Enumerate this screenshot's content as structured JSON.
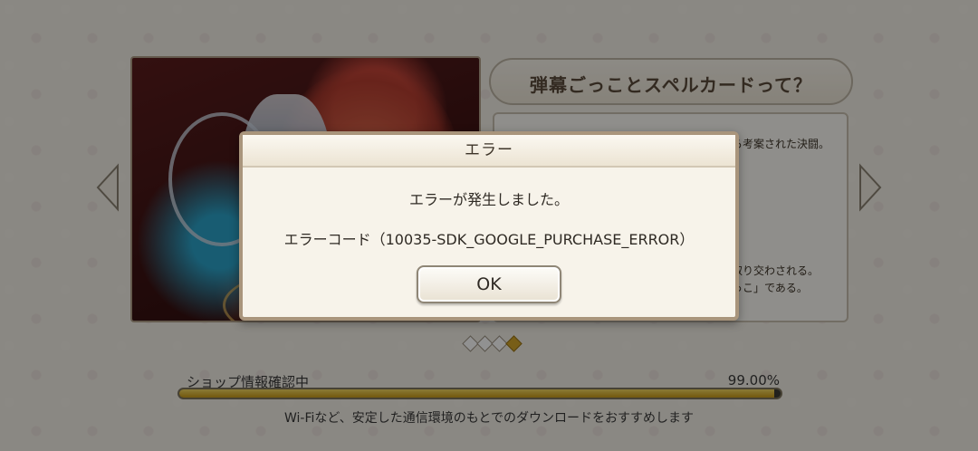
{
  "background": {
    "info_title": "弾幕ごっことスペルカードって？",
    "info_lines": [
      "ら考案された決闘。",
      "取り交わされる。",
      "っこ」である。"
    ],
    "pager": {
      "total": 4,
      "active_index": 3
    }
  },
  "loading": {
    "label": "ショップ情報確認中",
    "percent_text": "99.00%",
    "progress": 0.99,
    "note": "Wi-Fiなど、安定した通信環境のもとでのダウンロードをおすすめします"
  },
  "dialog": {
    "title": "エラー",
    "message": "エラーが発生しました。",
    "error_code": "エラーコード（10035-SDK_GOOGLE_PURCHASE_ERROR）",
    "ok_label": "OK"
  },
  "colors": {
    "accent": "#d3a52a",
    "dialog_border": "#a9957c"
  }
}
